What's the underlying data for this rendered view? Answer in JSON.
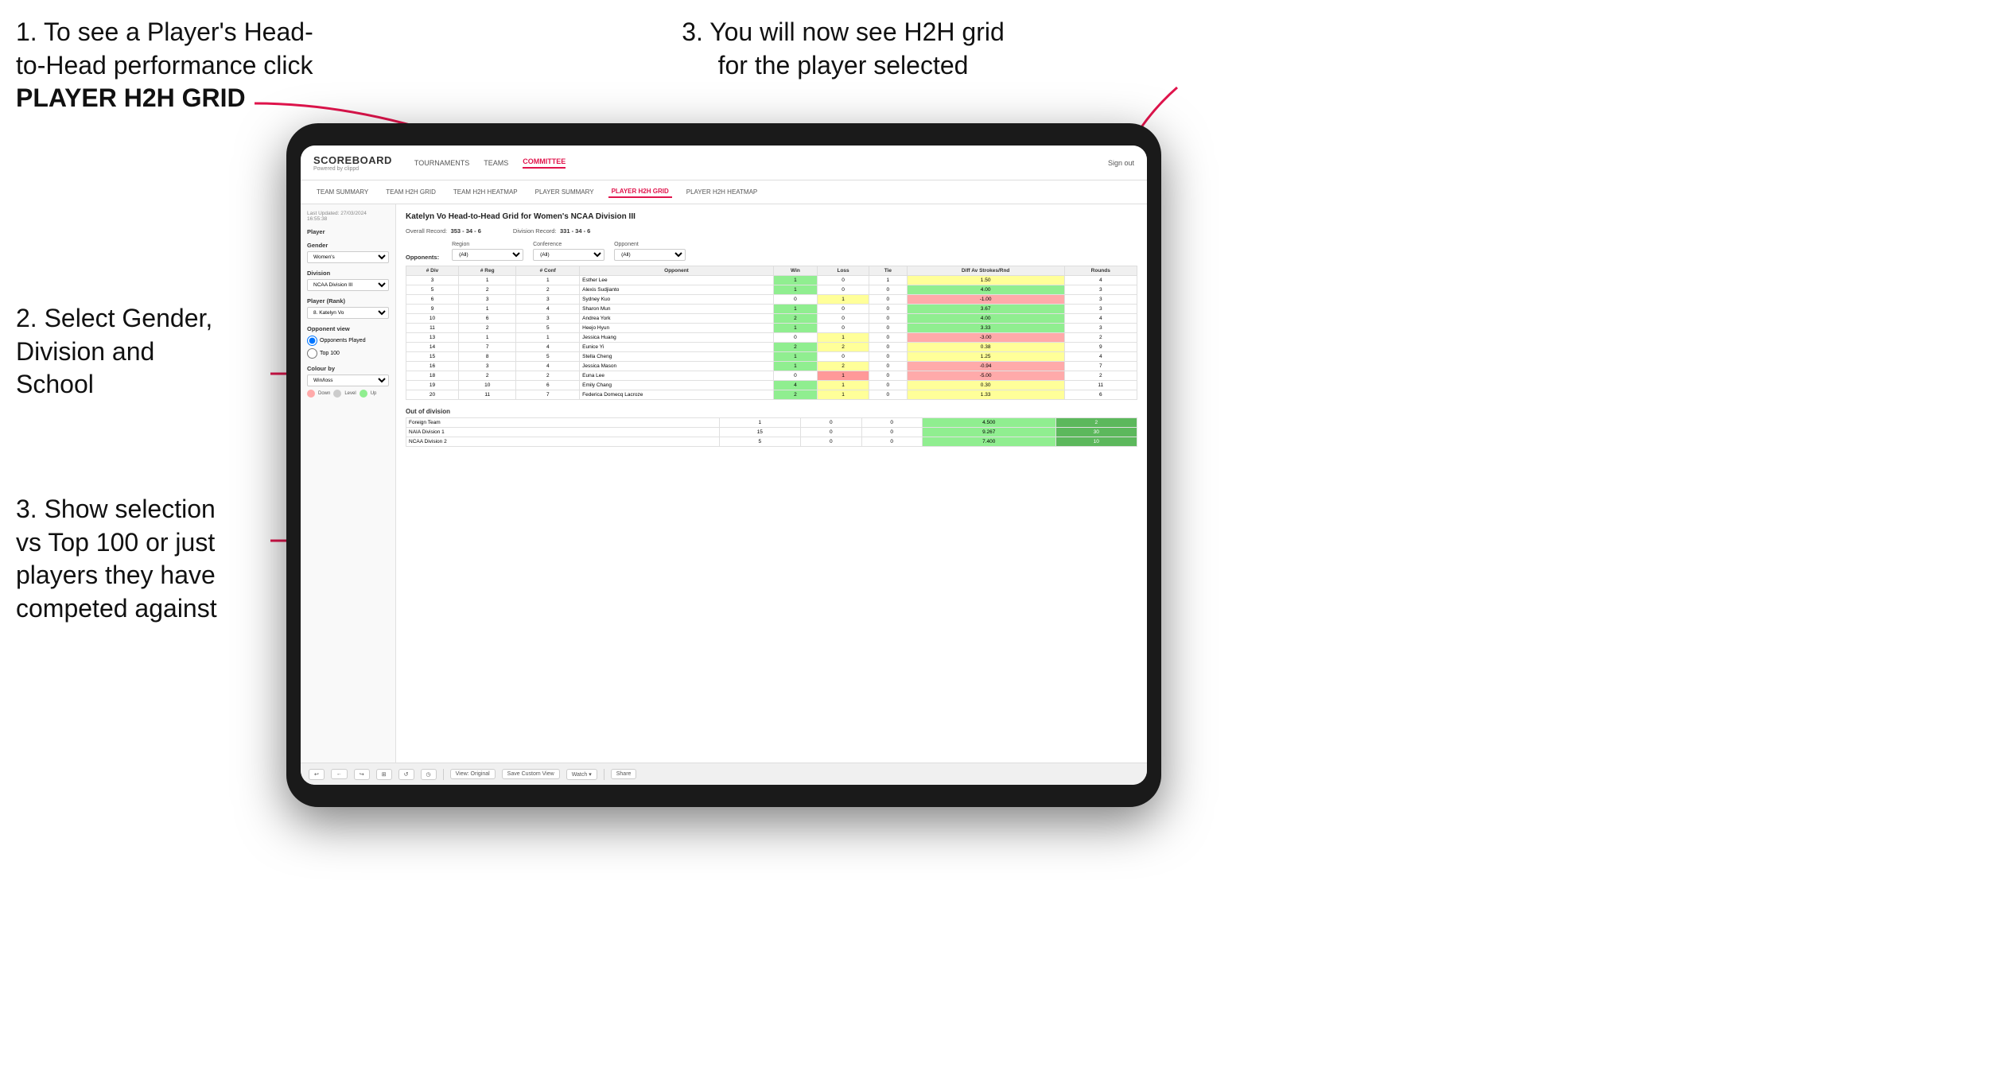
{
  "instructions": {
    "top_left_line1": "1. To see a Player's Head-",
    "top_left_line2": "to-Head performance click",
    "top_left_bold": "PLAYER H2H GRID",
    "top_right": "3. You will now see H2H grid\nfor the player selected",
    "mid_left_line1": "2. Select Gender,",
    "mid_left_line2": "Division and",
    "mid_left_line3": "School",
    "bottom_left_line1": "3. Show selection",
    "bottom_left_line2": "vs Top 100 or just",
    "bottom_left_line3": "players they have",
    "bottom_left_line4": "competed against"
  },
  "nav": {
    "logo": "SCOREBOARD",
    "logo_sub": "Powered by clippd",
    "items": [
      "TOURNAMENTS",
      "TEAMS",
      "COMMITTEE"
    ],
    "right": "Sign out"
  },
  "sub_nav": {
    "items": [
      "TEAM SUMMARY",
      "TEAM H2H GRID",
      "TEAM H2H HEATMAP",
      "PLAYER SUMMARY",
      "PLAYER H2H GRID",
      "PLAYER H2H HEATMAP"
    ]
  },
  "sidebar": {
    "date": "Last Updated: 27/03/2024\n16:55:38",
    "player_label": "Player",
    "gender_label": "Gender",
    "gender_value": "Women's",
    "division_label": "Division",
    "division_value": "NCAA Division III",
    "player_rank_label": "Player (Rank)",
    "player_rank_value": "8. Katelyn Vo",
    "opponent_view_label": "Opponent view",
    "radio1": "Opponents Played",
    "radio2": "Top 100",
    "colour_by_label": "Colour by",
    "colour_by_value": "Win/loss",
    "colours": [
      {
        "label": "Down",
        "color": "#ffcccc"
      },
      {
        "label": "Level",
        "color": "#cccccc"
      },
      {
        "label": "Up",
        "color": "#90ee90"
      }
    ]
  },
  "grid": {
    "title": "Katelyn Vo Head-to-Head Grid for Women's NCAA Division III",
    "overall_record_label": "Overall Record:",
    "overall_record_value": "353 - 34 - 6",
    "division_record_label": "Division Record:",
    "division_record_value": "331 - 34 - 6",
    "region_filter_label": "Region",
    "region_value": "(All)",
    "conference_filter_label": "Conference",
    "conference_value": "(All)",
    "opponent_filter_label": "Opponent",
    "opponent_value": "(All)",
    "opponents_label": "Opponents:",
    "table_headers": [
      "# Div",
      "# Reg",
      "# Conf",
      "Opponent",
      "Win",
      "Loss",
      "Tie",
      "Diff Av Strokes/Rnd",
      "Rounds"
    ],
    "rows": [
      {
        "div": "3",
        "reg": "1",
        "conf": "1",
        "opponent": "Esther Lee",
        "win": "1",
        "loss": "0",
        "tie": "1",
        "diff": "1.50",
        "rounds": "4",
        "win_color": "green",
        "loss_color": "none",
        "tie_color": "none"
      },
      {
        "div": "5",
        "reg": "2",
        "conf": "2",
        "opponent": "Alexis Sudjianto",
        "win": "1",
        "loss": "0",
        "tie": "0",
        "diff": "4.00",
        "rounds": "3",
        "win_color": "green",
        "loss_color": "none",
        "tie_color": "none"
      },
      {
        "div": "6",
        "reg": "3",
        "conf": "3",
        "opponent": "Sydney Kuo",
        "win": "0",
        "loss": "1",
        "tie": "0",
        "diff": "-1.00",
        "rounds": "3",
        "win_color": "none",
        "loss_color": "yellow",
        "tie_color": "none"
      },
      {
        "div": "9",
        "reg": "1",
        "conf": "4",
        "opponent": "Sharon Mun",
        "win": "1",
        "loss": "0",
        "tie": "0",
        "diff": "3.67",
        "rounds": "3",
        "win_color": "green",
        "loss_color": "none",
        "tie_color": "none"
      },
      {
        "div": "10",
        "reg": "6",
        "conf": "3",
        "opponent": "Andrea York",
        "win": "2",
        "loss": "0",
        "tie": "0",
        "diff": "4.00",
        "rounds": "4",
        "win_color": "green",
        "loss_color": "none",
        "tie_color": "none"
      },
      {
        "div": "11",
        "reg": "2",
        "conf": "5",
        "opponent": "Heejo Hyun",
        "win": "1",
        "loss": "0",
        "tie": "0",
        "diff": "3.33",
        "rounds": "3",
        "win_color": "green",
        "loss_color": "none",
        "tie_color": "none"
      },
      {
        "div": "13",
        "reg": "1",
        "conf": "1",
        "opponent": "Jessica Huang",
        "win": "0",
        "loss": "1",
        "tie": "0",
        "diff": "-3.00",
        "rounds": "2",
        "win_color": "none",
        "loss_color": "yellow",
        "tie_color": "none"
      },
      {
        "div": "14",
        "reg": "7",
        "conf": "4",
        "opponent": "Eunice Yi",
        "win": "2",
        "loss": "2",
        "tie": "0",
        "diff": "0.38",
        "rounds": "9",
        "win_color": "green",
        "loss_color": "yellow",
        "tie_color": "none"
      },
      {
        "div": "15",
        "reg": "8",
        "conf": "5",
        "opponent": "Stella Cheng",
        "win": "1",
        "loss": "0",
        "tie": "0",
        "diff": "1.25",
        "rounds": "4",
        "win_color": "green",
        "loss_color": "none",
        "tie_color": "none"
      },
      {
        "div": "16",
        "reg": "3",
        "conf": "4",
        "opponent": "Jessica Mason",
        "win": "1",
        "loss": "2",
        "tie": "0",
        "diff": "-0.94",
        "rounds": "7",
        "win_color": "green",
        "loss_color": "yellow",
        "tie_color": "none"
      },
      {
        "div": "18",
        "reg": "2",
        "conf": "2",
        "opponent": "Euna Lee",
        "win": "0",
        "loss": "1",
        "tie": "0",
        "diff": "-5.00",
        "rounds": "2",
        "win_color": "none",
        "loss_color": "red",
        "tie_color": "none"
      },
      {
        "div": "19",
        "reg": "10",
        "conf": "6",
        "opponent": "Emily Chang",
        "win": "4",
        "loss": "1",
        "tie": "0",
        "diff": "0.30",
        "rounds": "11",
        "win_color": "green",
        "loss_color": "yellow",
        "tie_color": "none"
      },
      {
        "div": "20",
        "reg": "11",
        "conf": "7",
        "opponent": "Federica Domecq Lacroze",
        "win": "2",
        "loss": "1",
        "tie": "0",
        "diff": "1.33",
        "rounds": "6",
        "win_color": "green",
        "loss_color": "yellow",
        "tie_color": "none"
      }
    ],
    "out_of_division_title": "Out of division",
    "out_of_division_rows": [
      {
        "opponent": "Foreign Team",
        "win": "1",
        "loss": "0",
        "tie": "0",
        "diff": "4.500",
        "rounds": "2"
      },
      {
        "opponent": "NAIA Division 1",
        "win": "15",
        "loss": "0",
        "tie": "0",
        "diff": "9.267",
        "rounds": "30"
      },
      {
        "opponent": "NCAA Division 2",
        "win": "5",
        "loss": "0",
        "tie": "0",
        "diff": "7.400",
        "rounds": "10"
      }
    ]
  },
  "toolbar": {
    "buttons": [
      "↩",
      "←",
      "↪",
      "⊞",
      "↺",
      "◷"
    ],
    "view_original": "View: Original",
    "save_custom_view": "Save Custom View",
    "watch": "Watch ▾",
    "share": "Share"
  }
}
